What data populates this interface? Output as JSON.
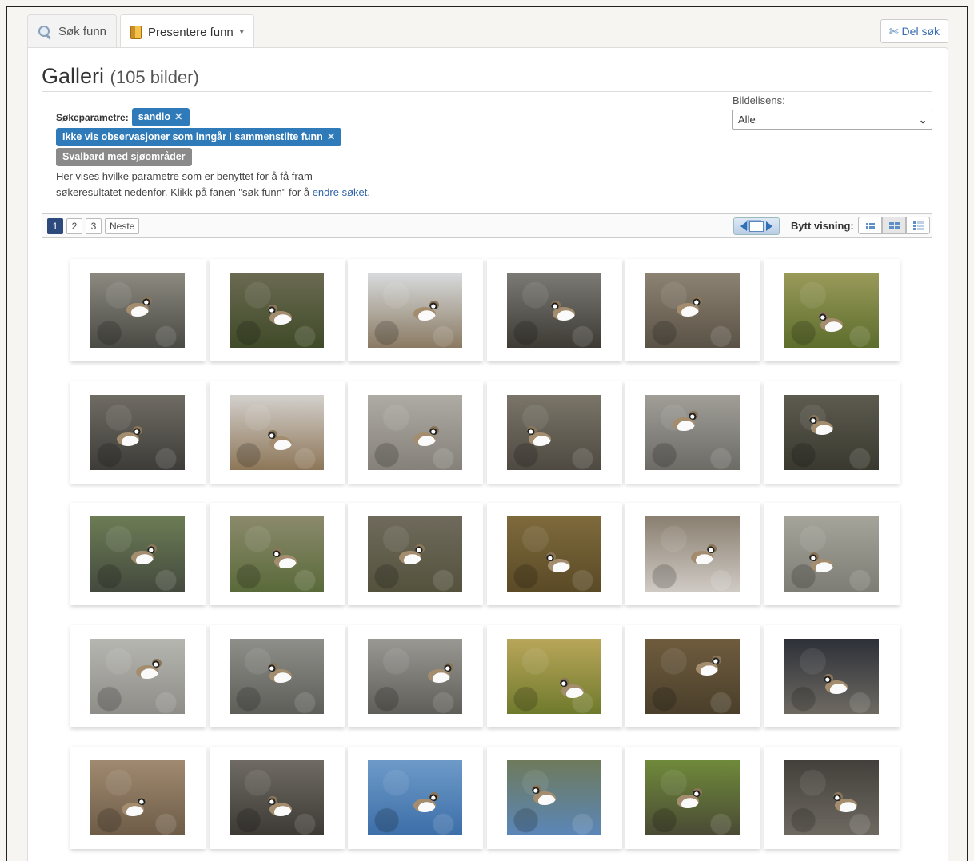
{
  "tabs": [
    {
      "label": "Søk funn",
      "icon": "search-icon"
    },
    {
      "label": "Presentere funn",
      "icon": "book-icon",
      "has_dropdown": true
    }
  ],
  "share_button": {
    "label": "Del søk",
    "icon": "scissors-icon"
  },
  "header": {
    "title": "Galleri",
    "count": "(105 bilder)"
  },
  "search_params": {
    "label": "Søkeparametre:",
    "tags": [
      {
        "text": "sandlo",
        "removable": true,
        "color": "#2f7ab8"
      },
      {
        "text": "Ikke vis observasjoner som inngår i sammenstilte funn",
        "removable": true,
        "color": "#2f7ab8"
      },
      {
        "text": "Svalbard med sjøområder",
        "removable": false,
        "color": "#8a8a8a"
      }
    ],
    "description_line1": "Her vises hvilke parametre som er benyttet for å få fram",
    "description_line2": "søkeresultatet nedenfor. Klikk på fanen \"søk funn\" for å",
    "description_link": "endre søket",
    "description_end": "."
  },
  "license": {
    "label": "Bildelisens:",
    "selected": "Alle"
  },
  "pager": {
    "pages": [
      "1",
      "2",
      "3"
    ],
    "current": "1",
    "next_label": "Neste"
  },
  "view_switch": {
    "label": "Bytt visning:",
    "options": [
      "small-grid-icon",
      "large-grid-icon",
      "list-icon"
    ],
    "active": "large-grid-icon"
  },
  "gallery": {
    "thumbnails": [
      {
        "bg": [
          "#8c8a80",
          "#4a4a44"
        ],
        "bird": [
          0.5,
          0.45
        ]
      },
      {
        "bg": [
          "#6b6a52",
          "#3f4a28"
        ],
        "bird": [
          0.55,
          0.55
        ]
      },
      {
        "bg": [
          "#d8dbdd",
          "#8a7a62"
        ],
        "bird": [
          0.6,
          0.5
        ]
      },
      {
        "bg": [
          "#7b7a74",
          "#3e3b35"
        ],
        "bird": [
          0.6,
          0.5
        ]
      },
      {
        "bg": [
          "#8d8373",
          "#5a5246"
        ],
        "bird": [
          0.45,
          0.45
        ]
      },
      {
        "bg": [
          "#9a9a5a",
          "#5c6d2c"
        ],
        "bird": [
          0.5,
          0.65
        ]
      },
      {
        "bg": [
          "#6f6c64",
          "#3e3c38"
        ],
        "bird": [
          0.4,
          0.55
        ]
      },
      {
        "bg": [
          "#d3d0cc",
          "#8d7658"
        ],
        "bird": [
          0.55,
          0.6
        ]
      },
      {
        "bg": [
          "#aeaba4",
          "#85817a"
        ],
        "bird": [
          0.6,
          0.55
        ]
      },
      {
        "bg": [
          "#7a7568",
          "#4e4a42"
        ],
        "bird": [
          0.35,
          0.55
        ]
      },
      {
        "bg": [
          "#a09e97",
          "#6d6b66"
        ],
        "bird": [
          0.4,
          0.35
        ]
      },
      {
        "bg": [
          "#5d5b50",
          "#3a392f"
        ],
        "bird": [
          0.4,
          0.4
        ]
      },
      {
        "bg": [
          "#6c7c55",
          "#444a3e"
        ],
        "bird": [
          0.55,
          0.5
        ]
      },
      {
        "bg": [
          "#8b8a6c",
          "#5a6a3a"
        ],
        "bird": [
          0.6,
          0.55
        ]
      },
      {
        "bg": [
          "#6f6a5c",
          "#54523d"
        ],
        "bird": [
          0.45,
          0.5
        ]
      },
      {
        "bg": [
          "#7e6a3c",
          "#5a4a26"
        ],
        "bird": [
          0.55,
          0.6
        ]
      },
      {
        "bg": [
          "#8a7f70",
          "#cfcac4"
        ],
        "bird": [
          0.6,
          0.5
        ]
      },
      {
        "bg": [
          "#a5a49a",
          "#7e7d75"
        ],
        "bird": [
          0.4,
          0.6
        ]
      },
      {
        "bg": [
          "#b6b6b1",
          "#8e8d88"
        ],
        "bird": [
          0.6,
          0.4
        ]
      },
      {
        "bg": [
          "#8f8f8a",
          "#5e5e59"
        ],
        "bird": [
          0.55,
          0.45
        ]
      },
      {
        "bg": [
          "#9a9893",
          "#5f5e58"
        ],
        "bird": [
          0.75,
          0.45
        ]
      },
      {
        "bg": [
          "#b9a65a",
          "#6f7a2c"
        ],
        "bird": [
          0.7,
          0.65
        ]
      },
      {
        "bg": [
          "#6f5c3e",
          "#4a3f2b"
        ],
        "bird": [
          0.65,
          0.35
        ]
      },
      {
        "bg": [
          "#2d3038",
          "#6e6a62"
        ],
        "bird": [
          0.55,
          0.6
        ]
      },
      {
        "bg": [
          "#a08a70",
          "#6e5c48"
        ],
        "bird": [
          0.45,
          0.6
        ]
      },
      {
        "bg": [
          "#6f6b64",
          "#3d3a35"
        ],
        "bird": [
          0.55,
          0.6
        ]
      },
      {
        "bg": [
          "#6d9ac8",
          "#3c6ea8"
        ],
        "bird": [
          0.6,
          0.55
        ]
      },
      {
        "bg": [
          "#6e7a5a",
          "#5a86b8"
        ],
        "bird": [
          0.4,
          0.45
        ]
      },
      {
        "bg": [
          "#6f8a3a",
          "#4a4a35"
        ],
        "bird": [
          0.45,
          0.5
        ]
      },
      {
        "bg": [
          "#43403b",
          "#6e6a62"
        ],
        "bird": [
          0.65,
          0.55
        ]
      }
    ]
  }
}
